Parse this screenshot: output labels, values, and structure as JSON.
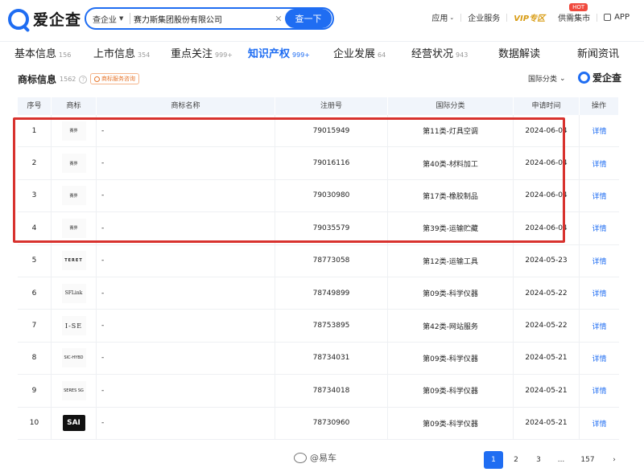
{
  "header": {
    "logo_text": "爱企查",
    "search": {
      "type_label": "查企业",
      "value": "赛力斯集团股份有限公司",
      "clear_icon": "close-icon",
      "button_label": "查一下"
    },
    "nav": {
      "app_store": "应用",
      "enterprise_service": "企业服务",
      "vip": "VIP专区",
      "supply": "供需集市",
      "hot_badge": "HOT",
      "app": "APP"
    }
  },
  "tabs": [
    {
      "label": "基本信息",
      "count": "156"
    },
    {
      "label": "上市信息",
      "count": "354"
    },
    {
      "label": "重点关注",
      "count": "999+"
    },
    {
      "label": "知识产权",
      "count": "999+",
      "active": true
    },
    {
      "label": "企业发展",
      "count": "64"
    },
    {
      "label": "经营状况",
      "count": "943"
    },
    {
      "label": "数据解读",
      "count": ""
    },
    {
      "label": "新闻资讯",
      "count": ""
    }
  ],
  "section": {
    "title": "商标信息",
    "count": "1562",
    "help_icon": "question-icon",
    "service_tag": "商标服务咨询",
    "filter_label": "国际分类",
    "watermark": "爱企查"
  },
  "table": {
    "headers": [
      "序号",
      "商标",
      "商标名称",
      "注册号",
      "国际分类",
      "申请时间",
      "操作"
    ],
    "rows": [
      {
        "no": "1",
        "mark": "赛界",
        "name": "-",
        "reg": "79015949",
        "cls": "第11类-灯具空调",
        "date": "2024-06-04",
        "op": "详情"
      },
      {
        "no": "2",
        "mark": "赛界",
        "name": "-",
        "reg": "79016116",
        "cls": "第40类-材料加工",
        "date": "2024-06-04",
        "op": "详情"
      },
      {
        "no": "3",
        "mark": "赛界",
        "name": "-",
        "reg": "79030980",
        "cls": "第17类-橡胶制品",
        "date": "2024-06-04",
        "op": "详情"
      },
      {
        "no": "4",
        "mark": "赛界",
        "name": "-",
        "reg": "79035579",
        "cls": "第39类-运输贮藏",
        "date": "2024-06-04",
        "op": "详情"
      },
      {
        "no": "5",
        "mark": "TERET",
        "name": "-",
        "reg": "78773058",
        "cls": "第12类-运输工具",
        "date": "2024-05-23",
        "op": "详情"
      },
      {
        "no": "6",
        "mark": "SFLink",
        "name": "-",
        "reg": "78749899",
        "cls": "第09类-科学仪器",
        "date": "2024-05-22",
        "op": "详情"
      },
      {
        "no": "7",
        "mark": "I-SE",
        "name": "-",
        "reg": "78753895",
        "cls": "第42类-网站服务",
        "date": "2024-05-22",
        "op": "详情"
      },
      {
        "no": "8",
        "mark": "SIC-HYBD",
        "name": "-",
        "reg": "78734031",
        "cls": "第09类-科学仪器",
        "date": "2024-05-21",
        "op": "详情"
      },
      {
        "no": "9",
        "mark": "SERES SG",
        "name": "-",
        "reg": "78734018",
        "cls": "第09类-科学仪器",
        "date": "2024-05-21",
        "op": "详情"
      },
      {
        "no": "10",
        "mark": "SAI",
        "name": "-",
        "reg": "78730960",
        "cls": "第09类-科学仪器",
        "date": "2024-05-21",
        "op": "详情"
      }
    ]
  },
  "pagination": {
    "pages": [
      "1",
      "2",
      "3",
      "...",
      "157"
    ],
    "next_icon": "chevron-right-icon",
    "next_glyph": "›"
  },
  "watermark_bottom": "@易车"
}
